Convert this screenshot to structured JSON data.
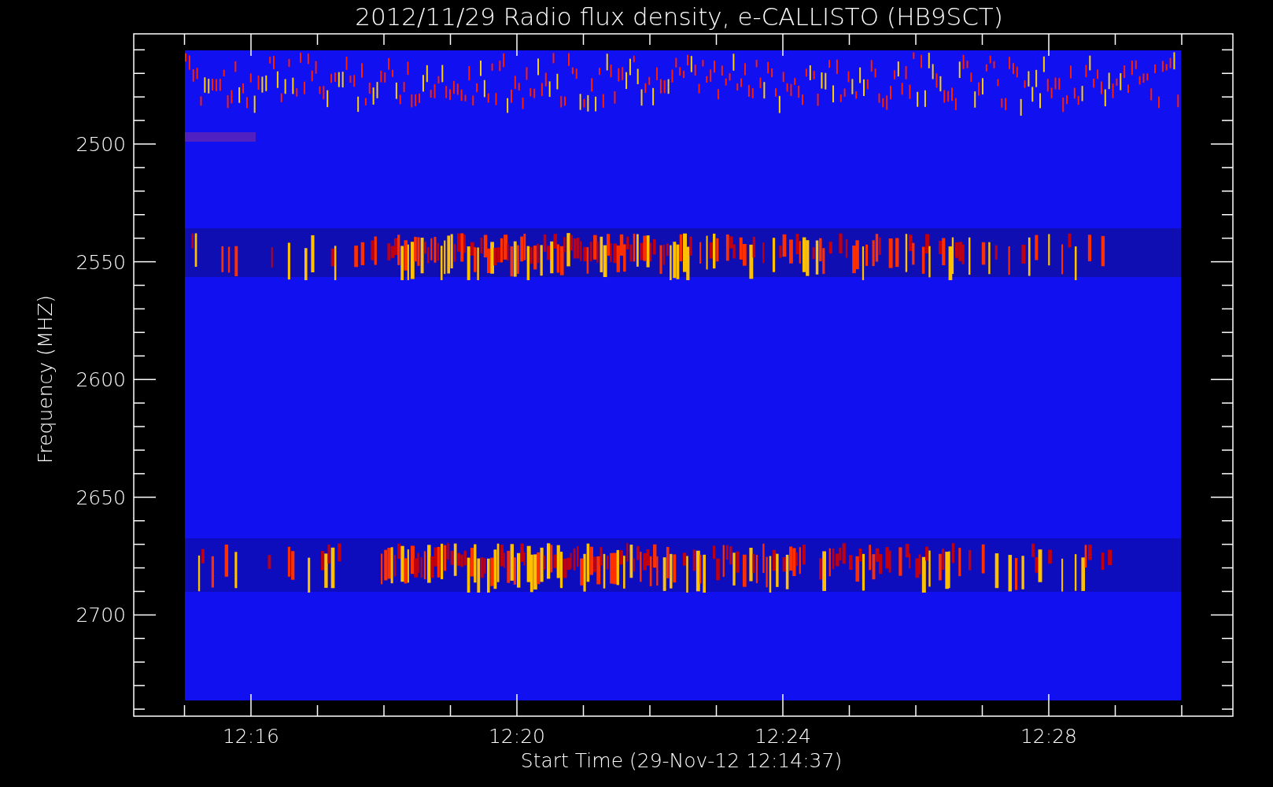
{
  "title": "2012/11/29  Radio flux density, e-CALLISTO (HB9SCT)",
  "y_axis": {
    "label": "Frequency (MHZ)",
    "ticks": [
      "2500",
      "2550",
      "2600",
      "2650",
      "2700"
    ]
  },
  "x_axis": {
    "label": "Start Time (29-Nov-12 12:14:37)",
    "ticks": [
      "12:16",
      "12:20",
      "12:24",
      "12:28"
    ]
  }
}
